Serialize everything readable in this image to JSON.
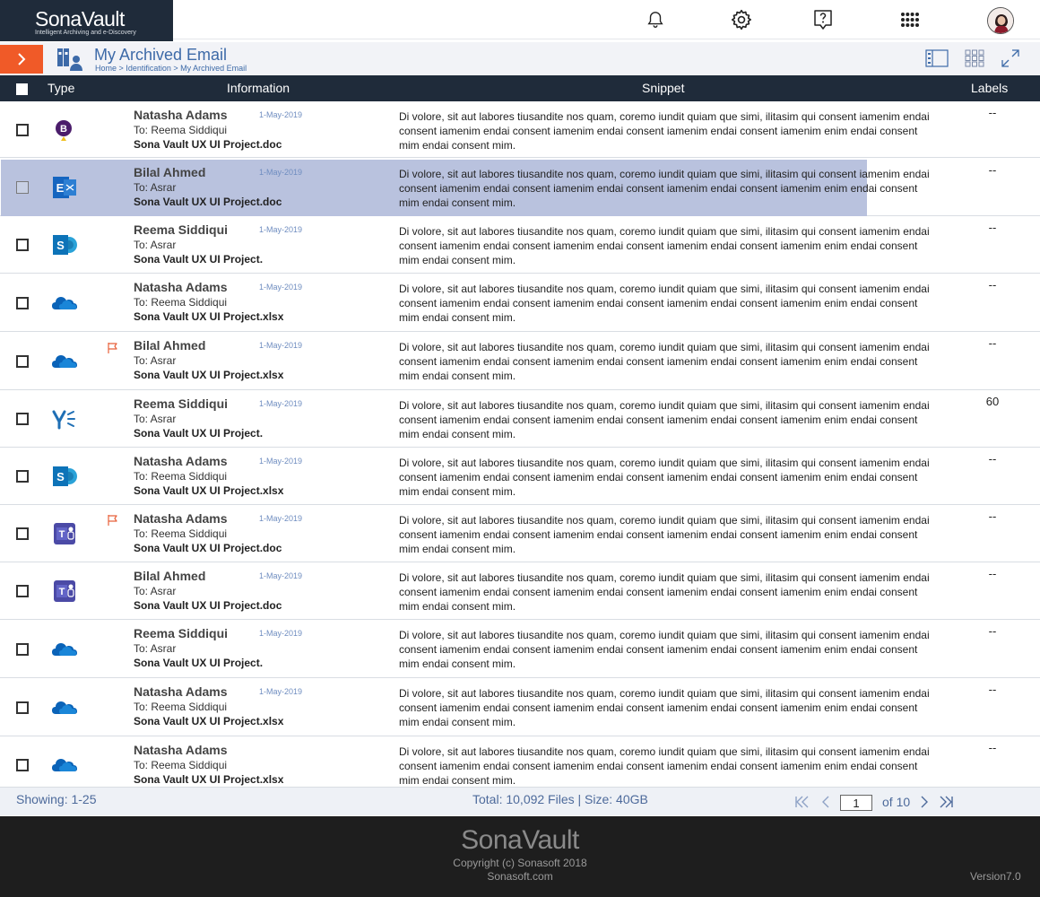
{
  "app": {
    "logo_title": "SonaVault",
    "logo_tagline": "Intelligent Archiving and e-Discovery"
  },
  "topbar": {
    "icons": [
      "bell-icon",
      "gear-icon",
      "help-icon",
      "apps-grid-icon"
    ]
  },
  "subheader": {
    "title": "My Archived Email",
    "breadcrumb": [
      "Home",
      "Identification",
      "My Archived Email"
    ],
    "separator": ">"
  },
  "table": {
    "columns": {
      "type": "Type",
      "information": "Information",
      "snippet": "Snippet",
      "labels": "Labels"
    },
    "rows": [
      {
        "icon": "bookings",
        "flag": false,
        "sender": "Natasha Adams",
        "date": "1-May-2019",
        "to": "To: Reema Siddiqui",
        "file": "Sona Vault UX UI Project.doc",
        "label": "--",
        "selected": false
      },
      {
        "icon": "exchange",
        "flag": false,
        "sender": "Bilal Ahmed",
        "date": "1-May-2019",
        "to": "To: Asrar",
        "file": "Sona Vault UX UI Project.doc",
        "label": "--",
        "selected": true
      },
      {
        "icon": "sharepoint",
        "flag": false,
        "sender": "Reema Siddiqui",
        "date": "1-May-2019",
        "to": "To: Asrar",
        "file": "Sona Vault UX UI Project.",
        "label": "--",
        "selected": false
      },
      {
        "icon": "onedrive",
        "flag": false,
        "sender": "Natasha Adams",
        "date": "1-May-2019",
        "to": "To: Reema Siddiqui",
        "file": "Sona Vault UX UI Project.xlsx",
        "label": "--",
        "selected": false
      },
      {
        "icon": "onedrive",
        "flag": true,
        "sender": "Bilal Ahmed",
        "date": "1-May-2019",
        "to": "To: Asrar",
        "file": "Sona Vault UX UI Project.xlsx",
        "label": "--",
        "selected": false
      },
      {
        "icon": "yammer",
        "flag": false,
        "sender": "Reema Siddiqui",
        "date": "1-May-2019",
        "to": "To: Asrar",
        "file": "Sona Vault UX UI Project.",
        "label": "60",
        "selected": false
      },
      {
        "icon": "sharepoint",
        "flag": false,
        "sender": "Natasha Adams",
        "date": "1-May-2019",
        "to": "To: Reema Siddiqui",
        "file": "Sona Vault UX UI Project.xlsx",
        "label": "--",
        "selected": false
      },
      {
        "icon": "teams",
        "flag": true,
        "sender": "Natasha Adams",
        "date": "1-May-2019",
        "to": "To: Reema Siddiqui",
        "file": "Sona Vault UX UI Project.doc",
        "label": "--",
        "selected": false
      },
      {
        "icon": "teams",
        "flag": false,
        "sender": "Bilal Ahmed",
        "date": "1-May-2019",
        "to": "To: Asrar",
        "file": "Sona Vault UX UI Project.doc",
        "label": "--",
        "selected": false
      },
      {
        "icon": "onedrive",
        "flag": false,
        "sender": "Reema Siddiqui",
        "date": "1-May-2019",
        "to": "To: Asrar",
        "file": "Sona Vault UX UI Project.",
        "label": "--",
        "selected": false
      },
      {
        "icon": "onedrive",
        "flag": false,
        "sender": "Natasha Adams",
        "date": "1-May-2019",
        "to": "To: Reema Siddiqui",
        "file": "Sona Vault UX UI Project.xlsx",
        "label": "--",
        "selected": false
      },
      {
        "icon": "onedrive",
        "flag": false,
        "sender": "Natasha Adams",
        "date": "",
        "to": "To: Reema Siddiqui",
        "file": "Sona Vault UX UI Project.xlsx",
        "label": "--",
        "selected": false
      }
    ],
    "snippet_text": "Di volore, sit aut labores tiusandite nos quam, coremo iundit quiam que simi, ilitasim qui consent iamenim endai consent iamenim endai consent iamenim endai consent iamenim endai consent iamenim enim endai consent mim endai consent mim."
  },
  "status": {
    "showing": "Showing:  1-25",
    "total": "Total: 10,092 Files |  Size: 40GB",
    "page_value": "1",
    "page_of": "of 10"
  },
  "footer": {
    "logo": "SonaVault",
    "copyright": "Copyright (c) Sonasoft 2018",
    "site": "Sonasoft.com",
    "version": "Version7.0"
  },
  "colors": {
    "navy": "#1f2b3a",
    "accent_orange": "#f05a28",
    "link_blue": "#3d6aa8",
    "selected_row": "#b9c2de"
  }
}
